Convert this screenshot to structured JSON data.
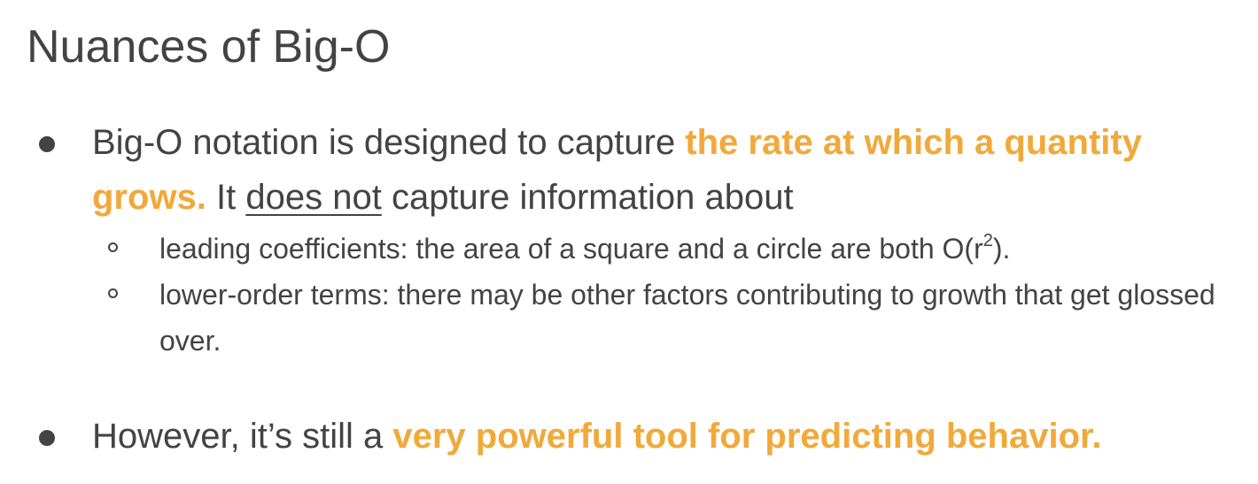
{
  "slide": {
    "title": "Nuances of Big-O",
    "bullet1": {
      "intro": "Big-O notation is designed to capture ",
      "highlight": "the rate at which a quantity grows.",
      "middle": " It ",
      "underlined": "does not",
      "tail": " capture information about"
    },
    "sub1": {
      "text": "leading coefficients: the area of a square and a circle are both O(r",
      "superscript": "2",
      "close": ")."
    },
    "sub2": {
      "text": "lower-order terms: there may be other factors contributing to growth that get glossed over."
    },
    "bullet2": {
      "intro": "However, it’s still a ",
      "highlight": "very powerful tool for predicting behavior."
    }
  },
  "colors": {
    "text": "#434343",
    "highlight": "#f1a93a",
    "background": "#ffffff"
  },
  "icons": {
    "main_bullet": "filled-circle-bullet-icon",
    "sub_bullet": "hollow-circle-bullet-icon"
  }
}
